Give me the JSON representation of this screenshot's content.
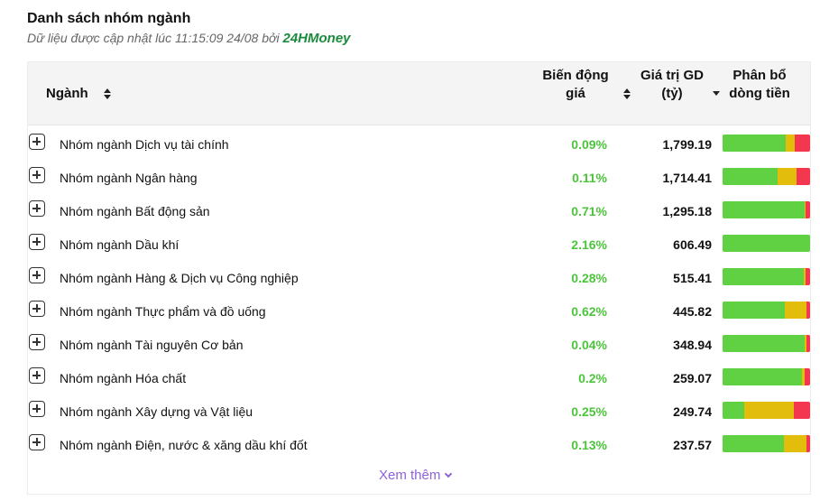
{
  "header": {
    "title": "Danh sách nhóm ngành",
    "subtitle_prefix": "Dữ liệu được cập nhật lúc 11:15:09 24/08 bởi",
    "brand": "24HMoney"
  },
  "table": {
    "columns": {
      "nganh": "Ngành",
      "bien_dong_gia": "Biến động giá",
      "gia_tri_gd": "Giá trị GD (tỷ)",
      "phan_bo": "Phân bổ dòng tiền"
    },
    "rows": [
      {
        "name": "Nhóm ngành Dịch vụ tài chính",
        "change": "0.09%",
        "value": "1,799.19",
        "flow": [
          0.72,
          0.1,
          0.18
        ]
      },
      {
        "name": "Nhóm ngành Ngân hàng",
        "change": "0.11%",
        "value": "1,714.41",
        "flow": [
          0.63,
          0.22,
          0.15
        ]
      },
      {
        "name": "Nhóm ngành Bất động sản",
        "change": "0.71%",
        "value": "1,295.18",
        "flow": [
          0.94,
          0.01,
          0.05
        ]
      },
      {
        "name": "Nhóm ngành Dầu khí",
        "change": "2.16%",
        "value": "606.49",
        "flow": [
          1.0,
          0.0,
          0.0
        ]
      },
      {
        "name": "Nhóm ngành Hàng & Dịch vụ Công nghiệp",
        "change": "0.28%",
        "value": "515.41",
        "flow": [
          0.93,
          0.02,
          0.05
        ]
      },
      {
        "name": "Nhóm ngành Thực phẩm và đồ uống",
        "change": "0.62%",
        "value": "445.82",
        "flow": [
          0.71,
          0.25,
          0.04
        ]
      },
      {
        "name": "Nhóm ngành Tài nguyên Cơ bản",
        "change": "0.04%",
        "value": "348.94",
        "flow": [
          0.94,
          0.02,
          0.04
        ]
      },
      {
        "name": "Nhóm ngành Hóa chất",
        "change": "0.2%",
        "value": "259.07",
        "flow": [
          0.91,
          0.03,
          0.06
        ]
      },
      {
        "name": "Nhóm ngành Xây dựng và Vật liệu",
        "change": "0.25%",
        "value": "249.74",
        "flow": [
          0.25,
          0.56,
          0.19
        ]
      },
      {
        "name": "Nhóm ngành Điện, nước & xăng dầu khí đốt",
        "change": "0.13%",
        "value": "237.57",
        "flow": [
          0.7,
          0.26,
          0.04
        ]
      }
    ]
  },
  "footer": {
    "more_label": "Xem thêm"
  },
  "colors": {
    "up": "#4cc43c",
    "flow_in": "#5fd143",
    "flow_neutral": "#e3bd0c",
    "flow_out": "#f2374f",
    "brand": "#1a8a3c",
    "link": "#8e62d8"
  },
  "icons": {
    "expand": "plus-square-icon",
    "sort": "sort-icon",
    "more": "chevron-down-icon"
  }
}
